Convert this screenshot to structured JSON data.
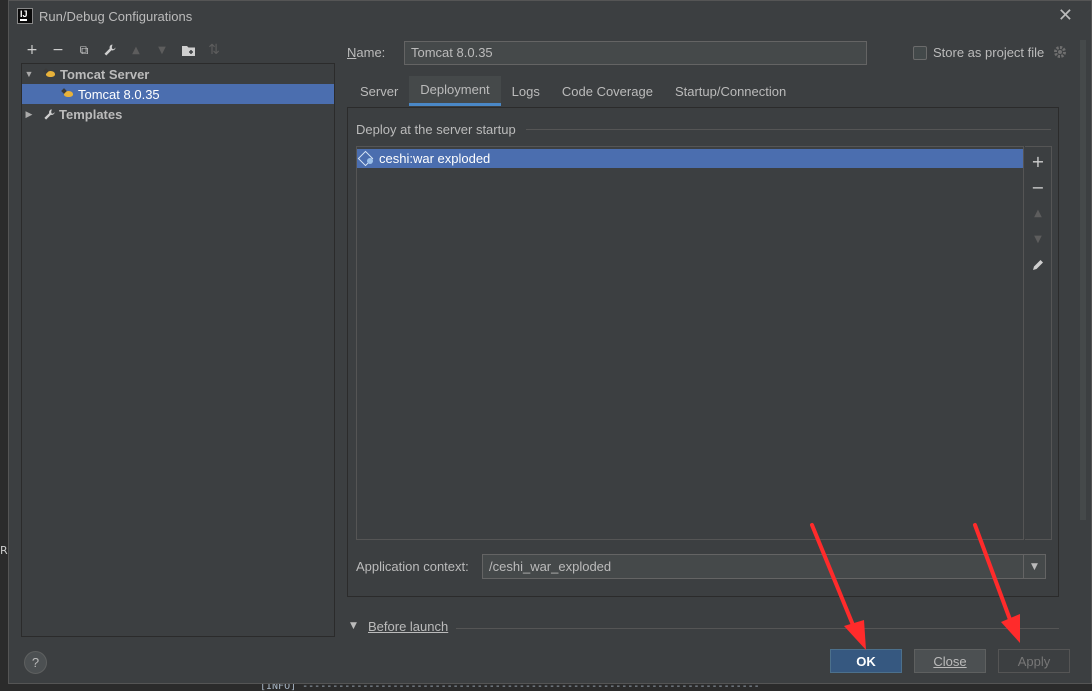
{
  "window": {
    "title": "Run/Debug Configurations",
    "close_glyph": "✕"
  },
  "background": {
    "edge_letter": "R",
    "console_text": "[INFO] ----------------------------------------------------------------------------"
  },
  "toolbar": {
    "add": "+",
    "remove": "−",
    "copy": "⧉",
    "edit": "🔧",
    "move_up": "▲",
    "move_down": "▼",
    "folder": "📁",
    "sort": "⇅"
  },
  "tree": {
    "items": [
      {
        "label": "Tomcat Server",
        "expanded": true,
        "caret": "▼"
      },
      {
        "label": "Tomcat 8.0.35",
        "selected": true
      },
      {
        "label": "Templates",
        "expanded": false,
        "caret": "▶"
      }
    ]
  },
  "form": {
    "name_label_u": "N",
    "name_label_rest": "ame:",
    "name_value": "Tomcat 8.0.35",
    "store_label": "Store as project file",
    "store_checked": false
  },
  "tabs": [
    {
      "label": "Server",
      "active": false
    },
    {
      "label": "Deployment",
      "active": true
    },
    {
      "label": "Logs",
      "active": false
    },
    {
      "label": "Code Coverage",
      "active": false
    },
    {
      "label": "Startup/Connection",
      "active": false
    }
  ],
  "deployment": {
    "section_title": "Deploy at the server startup",
    "artifacts": [
      "ceshi:war exploded"
    ],
    "side_tools": {
      "add": "+",
      "remove": "−",
      "up": "▲",
      "down": "▼",
      "edit": "✎"
    },
    "app_context_label": "Application context:",
    "app_context_value": "/ceshi_war_exploded",
    "dropdown_glyph": "▼"
  },
  "before_launch": {
    "caret": "▼",
    "label": "Before launch"
  },
  "buttons": {
    "help": "?",
    "ok": "OK",
    "close": "Close",
    "apply": "Apply"
  },
  "colors": {
    "dialog_bg": "#3c3f41",
    "selection": "#4b6eaf",
    "ok_button": "#365880",
    "annotation_arrow": "#ff2b2b"
  }
}
